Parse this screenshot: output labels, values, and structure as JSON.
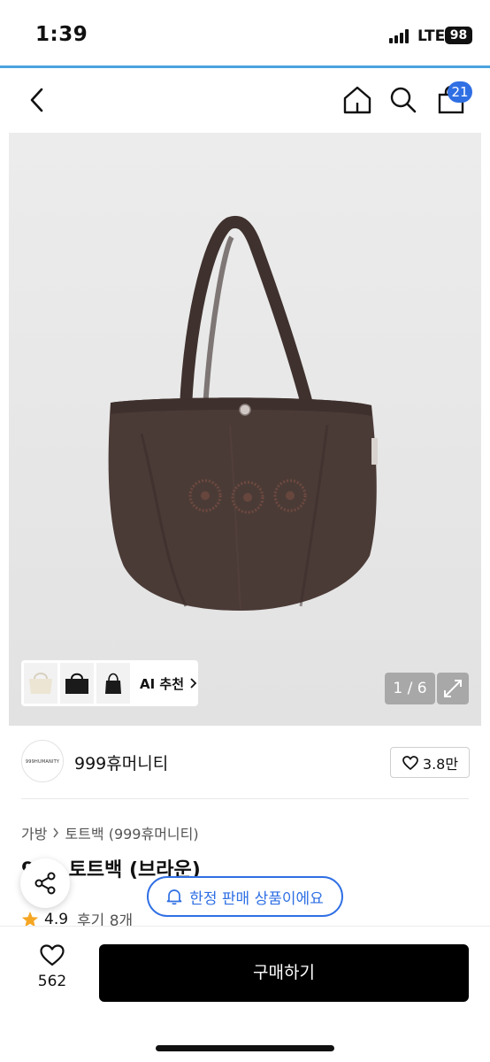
{
  "status_bar": {
    "time": "1:39",
    "network": "LTE",
    "battery": "98"
  },
  "nav": {
    "cart_count": "21"
  },
  "gallery": {
    "page_indicator": "1 / 6"
  },
  "ai_recommend": {
    "label": "AI 추천"
  },
  "shop": {
    "logo_text": "999HUMANITY",
    "name": "999휴머니티",
    "likes": "3.8만"
  },
  "breadcrumb": {
    "category": "가방",
    "subcategory": "토트백 (999휴머니티)"
  },
  "product": {
    "title": "999 토트백 (브라운)",
    "rating": "4.9",
    "reviews": "후기 8개"
  },
  "limited_notice": "한정 판매 상품이에요",
  "bottom": {
    "wish_count": "562",
    "buy_label": "구매하기"
  },
  "colors": {
    "accent": "#2f6fe4",
    "bag_brown": "#4b3b37",
    "star": "#f5a623"
  }
}
